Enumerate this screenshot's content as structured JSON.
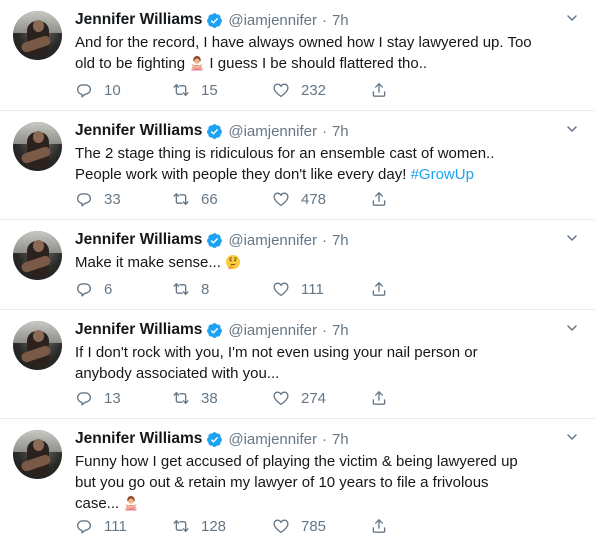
{
  "account": {
    "name": "Jennifer Williams",
    "handle": "@iamjennifer",
    "separator": "·",
    "verified": true
  },
  "colors": {
    "link": "#1da1f2",
    "secondary": "#657786",
    "text": "#14171a",
    "divider": "#e6ecf0"
  },
  "tweets": [
    {
      "time": "7h",
      "text_1": "And for the record, I have always owned how I stay lawyered up. Too",
      "text_2a": "old to be fighting ",
      "emoji_2": "person-gesturing-no-emoji",
      "text_2b": " I guess I be should flattered tho..",
      "replies": "10",
      "retweets": "15",
      "likes": "232"
    },
    {
      "time": "7h",
      "text_1": "The 2 stage thing is ridiculous for an ensemble cast of women..",
      "text_2a": "People work with people they don't like every day! ",
      "hashtag": "#GrowUp",
      "replies": "33",
      "retweets": "66",
      "likes": "478"
    },
    {
      "time": "7h",
      "text_1": "Make it make sense... ",
      "emoji_1": "thinking-face-emoji",
      "replies": "6",
      "retweets": "8",
      "likes": "111"
    },
    {
      "time": "7h",
      "text_1": "If I don't rock with you, I'm not even using your nail person or",
      "text_2": "anybody associated with you...",
      "replies": "13",
      "retweets": "38",
      "likes": "274"
    },
    {
      "time": "7h",
      "text_1": "Funny how I get accused of playing the victim & being lawyered up",
      "text_2": "but you go out & retain my lawyer of 10 years to file a frivolous",
      "text_3": "case... ",
      "emoji_3": "person-gesturing-no-emoji",
      "replies": "111",
      "retweets": "128",
      "likes": "785"
    }
  ]
}
